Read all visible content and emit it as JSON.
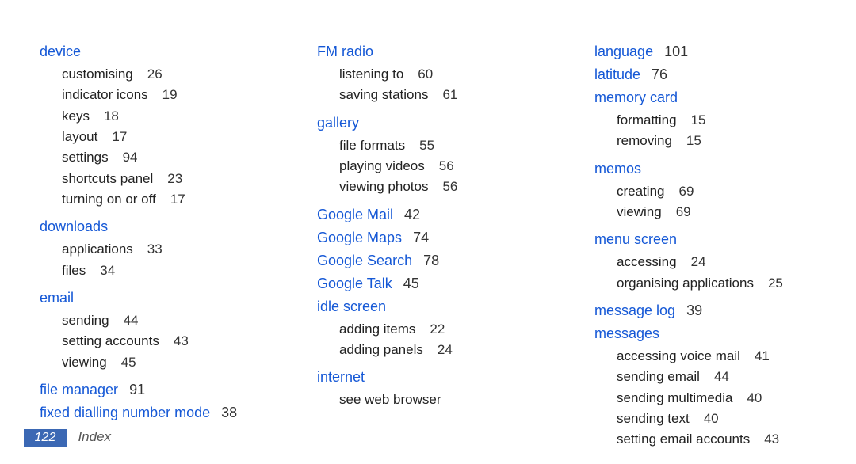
{
  "footer": {
    "page_number": "122",
    "section": "Index"
  },
  "index": {
    "columns": [
      [
        {
          "type": "topic",
          "label": "device"
        },
        {
          "type": "sub",
          "label": "customising",
          "page": "26"
        },
        {
          "type": "sub",
          "label": "indicator icons",
          "page": "19"
        },
        {
          "type": "sub",
          "label": "keys",
          "page": "18"
        },
        {
          "type": "sub",
          "label": "layout",
          "page": "17"
        },
        {
          "type": "sub",
          "label": "settings",
          "page": "94"
        },
        {
          "type": "sub",
          "label": "shortcuts panel",
          "page": "23"
        },
        {
          "type": "sub",
          "label": "turning on or off",
          "page": "17"
        },
        {
          "type": "gap"
        },
        {
          "type": "topic",
          "label": "downloads"
        },
        {
          "type": "sub",
          "label": "applications",
          "page": "33"
        },
        {
          "type": "sub",
          "label": "files",
          "page": "34"
        },
        {
          "type": "gap"
        },
        {
          "type": "topic",
          "label": "email"
        },
        {
          "type": "sub",
          "label": "sending",
          "page": "44"
        },
        {
          "type": "sub",
          "label": "setting accounts",
          "page": "43"
        },
        {
          "type": "sub",
          "label": "viewing",
          "page": "45"
        },
        {
          "type": "gap"
        },
        {
          "type": "topic",
          "label": "file manager",
          "page": "91"
        },
        {
          "type": "topic",
          "label": "fixed dialling number mode",
          "page": "38"
        }
      ],
      [
        {
          "type": "topic",
          "label": "FM radio"
        },
        {
          "type": "sub",
          "label": "listening to",
          "page": "60"
        },
        {
          "type": "sub",
          "label": "saving stations",
          "page": "61"
        },
        {
          "type": "gap"
        },
        {
          "type": "topic",
          "label": "gallery"
        },
        {
          "type": "sub",
          "label": "file formats",
          "page": "55"
        },
        {
          "type": "sub",
          "label": "playing videos",
          "page": "56"
        },
        {
          "type": "sub",
          "label": "viewing photos",
          "page": "56"
        },
        {
          "type": "gap"
        },
        {
          "type": "topic",
          "label": "Google Mail",
          "page": "42"
        },
        {
          "type": "topic",
          "label": "Google Maps",
          "page": "74"
        },
        {
          "type": "topic",
          "label": "Google Search",
          "page": "78"
        },
        {
          "type": "topic",
          "label": "Google Talk",
          "page": "45"
        },
        {
          "type": "topic",
          "label": "idle screen"
        },
        {
          "type": "sub",
          "label": "adding items",
          "page": "22"
        },
        {
          "type": "sub",
          "label": "adding panels",
          "page": "24"
        },
        {
          "type": "gap"
        },
        {
          "type": "topic",
          "label": "internet"
        },
        {
          "type": "see",
          "label": "see web browser"
        }
      ],
      [
        {
          "type": "topic",
          "label": "language",
          "page": "101"
        },
        {
          "type": "topic",
          "label": "latitude",
          "page": "76"
        },
        {
          "type": "topic",
          "label": "memory card"
        },
        {
          "type": "sub",
          "label": "formatting",
          "page": "15"
        },
        {
          "type": "sub",
          "label": "removing",
          "page": "15"
        },
        {
          "type": "gap"
        },
        {
          "type": "topic",
          "label": "memos"
        },
        {
          "type": "sub",
          "label": "creating",
          "page": "69"
        },
        {
          "type": "sub",
          "label": "viewing",
          "page": "69"
        },
        {
          "type": "gap"
        },
        {
          "type": "topic",
          "label": "menu screen"
        },
        {
          "type": "sub",
          "label": "accessing",
          "page": "24"
        },
        {
          "type": "sub",
          "label": "organising applications",
          "page": "25"
        },
        {
          "type": "gap"
        },
        {
          "type": "topic",
          "label": "message log",
          "page": "39"
        },
        {
          "type": "topic",
          "label": "messages"
        },
        {
          "type": "sub",
          "label": "accessing voice mail",
          "page": "41"
        },
        {
          "type": "sub",
          "label": "sending email",
          "page": "44"
        },
        {
          "type": "sub",
          "label": "sending multimedia",
          "page": "40"
        },
        {
          "type": "sub",
          "label": "sending text",
          "page": "40"
        },
        {
          "type": "sub",
          "label": "setting email accounts",
          "page": "43"
        }
      ]
    ]
  }
}
